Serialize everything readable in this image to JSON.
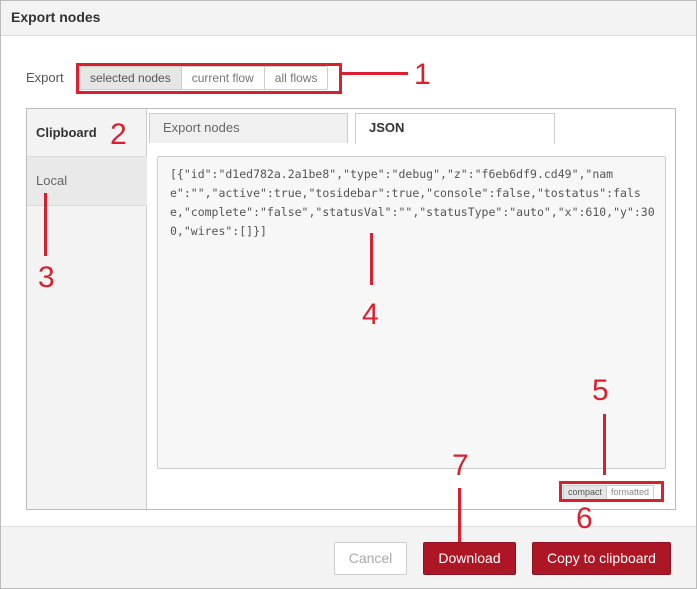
{
  "dialog": {
    "title": "Export nodes"
  },
  "export": {
    "label": "Export",
    "options": [
      "selected nodes",
      "current flow",
      "all flows"
    ],
    "selected": "selected nodes"
  },
  "sidebar": {
    "heading": "Clipboard",
    "items": [
      {
        "label": "Local"
      }
    ]
  },
  "tabs": [
    {
      "label": "Export nodes"
    },
    {
      "label": "JSON"
    }
  ],
  "editor": {
    "content": "[{\"id\":\"d1ed782a.2a1be8\",\"type\":\"debug\",\"z\":\"f6eb6df9.cd49\",\"name\":\"\",\"active\":true,\"tosidebar\":true,\"console\":false,\"tostatus\":false,\"complete\":\"false\",\"statusVal\":\"\",\"statusType\":\"auto\",\"x\":610,\"y\":300,\"wires\":[]}]"
  },
  "format": {
    "options": [
      "compact",
      "formatted"
    ],
    "selected": "compact"
  },
  "footer": {
    "cancel": "Cancel",
    "download": "Download",
    "copy": "Copy to clipboard"
  },
  "annotations": {
    "labels": [
      "1",
      "2",
      "3",
      "4",
      "5",
      "6",
      "7"
    ],
    "color": "#d9202f"
  },
  "colors": {
    "primary": "#ad1625",
    "panel_bg": "#f3f3f3"
  }
}
